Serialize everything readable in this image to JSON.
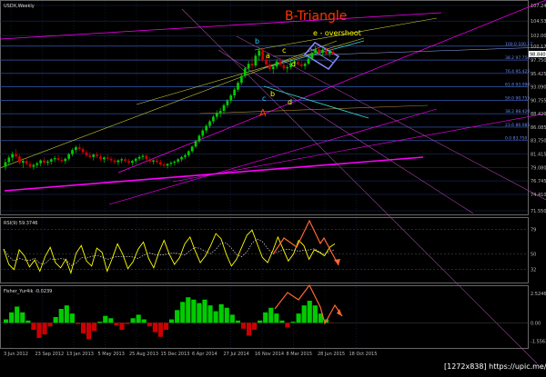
{
  "chart_data": {
    "type": "candlestick",
    "main": {
      "label": "USDX,Weekly",
      "y_ticks": [
        "107.24",
        "104.53",
        "102.00",
        "100.17",
        "97.750",
        "95.425",
        "93.090",
        "90.755",
        "88.420",
        "86.085",
        "83.750",
        "81.415",
        "79.080",
        "76.745",
        "74.410",
        "71.550"
      ],
      "ylim": [
        71.55,
        107.24
      ],
      "current_price": "98.840",
      "ohlc": [
        [
          79.2,
          80.6,
          78.6,
          80.0
        ],
        [
          80.0,
          81.2,
          79.4,
          80.8
        ],
        [
          80.8,
          81.8,
          80.2,
          81.4
        ],
        [
          81.4,
          82.3,
          80.6,
          81.0
        ],
        [
          81.0,
          81.4,
          79.6,
          79.9
        ],
        [
          79.9,
          80.6,
          79.0,
          80.2
        ],
        [
          80.2,
          80.9,
          79.5,
          79.7
        ],
        [
          79.7,
          80.2,
          78.9,
          79.2
        ],
        [
          79.2,
          79.8,
          78.7,
          79.5
        ],
        [
          79.5,
          80.1,
          79.0,
          79.8
        ],
        [
          79.8,
          80.5,
          79.3,
          80.3
        ],
        [
          80.3,
          80.8,
          79.6,
          79.9
        ],
        [
          79.9,
          80.4,
          79.4,
          80.1
        ],
        [
          80.1,
          80.7,
          79.6,
          80.5
        ],
        [
          80.5,
          81.1,
          80.0,
          80.7
        ],
        [
          80.7,
          81.3,
          80.1,
          80.4
        ],
        [
          80.4,
          80.9,
          79.8,
          80.2
        ],
        [
          80.2,
          80.8,
          79.7,
          80.6
        ],
        [
          80.6,
          81.6,
          80.3,
          81.4
        ],
        [
          81.4,
          82.4,
          81.0,
          82.1
        ],
        [
          82.1,
          82.9,
          81.6,
          82.6
        ],
        [
          82.6,
          83.2,
          81.9,
          82.3
        ],
        [
          82.3,
          82.7,
          81.4,
          81.7
        ],
        [
          81.7,
          82.1,
          80.9,
          81.2
        ],
        [
          81.2,
          81.7,
          80.6,
          80.9
        ],
        [
          80.9,
          81.5,
          80.3,
          81.3
        ],
        [
          81.3,
          81.8,
          80.7,
          81.0
        ],
        [
          81.0,
          81.4,
          80.2,
          80.5
        ],
        [
          80.5,
          81.0,
          79.9,
          80.8
        ],
        [
          80.8,
          81.3,
          80.2,
          80.6
        ],
        [
          80.6,
          81.0,
          80.0,
          80.3
        ],
        [
          80.3,
          80.7,
          79.6,
          80.0
        ],
        [
          80.0,
          80.5,
          79.5,
          80.3
        ],
        [
          80.3,
          80.8,
          79.8,
          80.5
        ],
        [
          80.5,
          80.9,
          79.9,
          80.2
        ],
        [
          80.2,
          80.6,
          79.6,
          79.9
        ],
        [
          79.9,
          80.4,
          79.4,
          80.2
        ],
        [
          80.2,
          80.8,
          79.7,
          80.6
        ],
        [
          80.6,
          81.2,
          80.2,
          80.9
        ],
        [
          80.9,
          81.4,
          80.4,
          81.1
        ],
        [
          81.1,
          81.4,
          80.3,
          80.5
        ],
        [
          80.5,
          80.9,
          79.8,
          80.1
        ],
        [
          80.1,
          80.5,
          79.6,
          80.3
        ],
        [
          80.3,
          80.7,
          79.8,
          80.0
        ],
        [
          80.0,
          80.4,
          79.3,
          79.6
        ],
        [
          79.6,
          80.0,
          79.1,
          79.4
        ],
        [
          79.4,
          79.8,
          78.9,
          79.7
        ],
        [
          79.7,
          80.2,
          79.2,
          79.9
        ],
        [
          79.9,
          80.3,
          79.4,
          80.1
        ],
        [
          80.1,
          80.7,
          79.8,
          80.5
        ],
        [
          80.5,
          81.1,
          80.1,
          80.9
        ],
        [
          80.9,
          81.5,
          80.5,
          81.2
        ],
        [
          81.2,
          82.1,
          80.9,
          81.9
        ],
        [
          81.9,
          82.9,
          81.6,
          82.7
        ],
        [
          82.7,
          83.9,
          82.4,
          83.6
        ],
        [
          83.6,
          84.9,
          83.3,
          84.6
        ],
        [
          84.6,
          85.8,
          84.2,
          85.5
        ],
        [
          85.5,
          86.6,
          85.0,
          86.3
        ],
        [
          86.3,
          87.4,
          85.9,
          87.1
        ],
        [
          87.1,
          88.2,
          86.7,
          87.9
        ],
        [
          87.9,
          89.0,
          87.4,
          88.5
        ],
        [
          88.5,
          89.4,
          87.8,
          88.9
        ],
        [
          88.9,
          90.2,
          88.4,
          89.9
        ],
        [
          89.9,
          91.0,
          89.4,
          90.7
        ],
        [
          90.7,
          91.9,
          90.2,
          91.6
        ],
        [
          91.6,
          92.9,
          91.1,
          92.6
        ],
        [
          92.6,
          94.1,
          92.2,
          93.8
        ],
        [
          93.8,
          95.4,
          93.4,
          95.0
        ],
        [
          95.0,
          96.6,
          94.6,
          96.3
        ],
        [
          96.3,
          97.6,
          95.6,
          97.1
        ],
        [
          97.1,
          98.3,
          96.2,
          96.8
        ],
        [
          96.8,
          98.9,
          96.4,
          98.5
        ],
        [
          98.5,
          100.0,
          97.6,
          99.4
        ],
        [
          99.4,
          99.9,
          97.4,
          97.8
        ],
        [
          97.8,
          98.6,
          96.5,
          97.0
        ],
        [
          97.0,
          97.7,
          95.8,
          96.2
        ],
        [
          96.2,
          97.0,
          95.4,
          96.6
        ],
        [
          96.6,
          97.9,
          96.2,
          97.5
        ],
        [
          97.5,
          98.2,
          96.6,
          96.9
        ],
        [
          96.9,
          97.5,
          95.9,
          96.3
        ],
        [
          96.3,
          96.9,
          95.6,
          96.5
        ],
        [
          96.5,
          97.5,
          96.1,
          97.2
        ],
        [
          97.2,
          97.9,
          96.7,
          97.4
        ],
        [
          97.4,
          98.1,
          96.8,
          97.0
        ],
        [
          97.0,
          97.6,
          96.3,
          96.7
        ],
        [
          96.7,
          97.4,
          96.1,
          97.1
        ],
        [
          97.1,
          98.3,
          96.9,
          98.0
        ],
        [
          98.0,
          99.3,
          97.7,
          99.0
        ],
        [
          99.0,
          100.2,
          98.6,
          99.6
        ],
        [
          99.6,
          100.1,
          98.7,
          99.0
        ],
        [
          99.0,
          99.8,
          98.4,
          99.4
        ],
        [
          99.4,
          100.0,
          98.7,
          98.9
        ],
        [
          98.9,
          99.6,
          98.3,
          99.2
        ],
        [
          99.2,
          99.8,
          98.6,
          98.8
        ]
      ],
      "labels": [
        "B-Triangle",
        "e - overshoot",
        "a",
        "b",
        "c",
        "d",
        "A",
        "b",
        "c",
        "d"
      ],
      "fib_levels": [
        "100.0 100.17",
        "38.2 97.750",
        "76.4 95.425",
        "61.8 93.090",
        "50.0 90.755",
        "38.2 88.420",
        "23.6 86.085",
        "0.0 83.750"
      ]
    },
    "rsi": {
      "label": "RSI(9) 59.3746",
      "y_ticks": [
        "79",
        "50",
        "32"
      ],
      "ylim": [
        20,
        90
      ],
      "values": [
        56,
        38,
        32,
        55,
        48,
        35,
        43,
        30,
        47,
        58,
        40,
        34,
        44,
        28,
        51,
        60,
        42,
        36,
        57,
        52,
        30,
        45,
        62,
        50,
        33,
        41,
        56,
        64,
        45,
        34,
        52,
        66,
        50,
        38,
        46,
        62,
        70,
        54,
        40,
        48,
        60,
        74,
        68,
        50,
        36,
        44,
        58,
        72,
        78,
        62,
        46,
        40,
        54,
        70,
        56,
        42,
        50,
        66,
        60,
        44,
        55,
        52,
        48,
        58,
        62
      ]
    },
    "fisher": {
      "label": "Fisher_Yur4ik -0.0239",
      "y_ticks": [
        "2.5246",
        "0.00",
        "-1.5563"
      ],
      "ylim": [
        -2.0,
        3.0
      ],
      "values": [
        0.3,
        0.9,
        1.4,
        0.9,
        0.2,
        -0.6,
        -1.3,
        -1.0,
        -0.3,
        0.5,
        1.2,
        1.5,
        0.8,
        -0.1,
        -0.9,
        -1.4,
        -0.7,
        0.1,
        0.6,
        0.4,
        -0.2,
        -0.6,
        -0.1,
        0.4,
        0.7,
        0.3,
        -0.3,
        -0.8,
        -1.2,
        -0.6,
        0.3,
        1.1,
        1.8,
        2.2,
        2.0,
        1.7,
        2.0,
        1.5,
        1.0,
        1.6,
        1.3,
        0.7,
        0.2,
        -0.5,
        -1.1,
        -0.6,
        0.2,
        0.9,
        1.3,
        0.8,
        0.2,
        -0.4,
        0.1,
        0.8,
        1.5,
        1.9,
        1.5,
        0.8,
        0.3,
        -0.02
      ]
    },
    "x_ticks": [
      "3 Jun 2012",
      "23 Sep 2012",
      "13 Jan 2013",
      "5 May 2013",
      "25 Aug 2013",
      "15 Dec 2013",
      "6 Apr 2014",
      "27 Jul 2014",
      "16 Nov 2014",
      "8 Mar 2015",
      "28 Jun 2015",
      "18 Oct 2015"
    ],
    "colors": {
      "bull": "#00cc00",
      "bear": "#cc0000",
      "rsi_line": "#ffff00",
      "magenta": "#ff00ff",
      "cyan": "#33cccc",
      "annotation": "#ff3300",
      "wave_label": "#33ccff",
      "grid": "#1a2a5a"
    }
  },
  "watermark": "[1272x838] https://upic.me/"
}
